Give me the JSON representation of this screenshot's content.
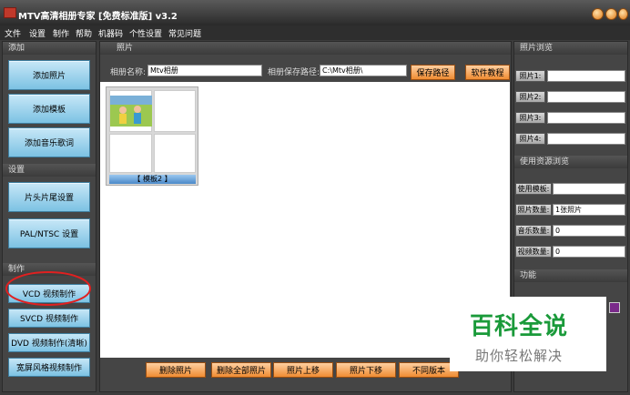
{
  "window": {
    "title": "MTV高清相册专家 [免费标准版] v3.2"
  },
  "menu": [
    "文件",
    "设置",
    "制作",
    "帮助",
    "机器码",
    "个性设置",
    "常见问题"
  ],
  "left": {
    "add_header": "添加",
    "add_photo": "添加照片",
    "add_template": "添加模板",
    "add_music": "添加音乐歌词",
    "settings_header": "设置",
    "head_tail": "片头片尾设置",
    "pal_ntsc": "PAL/NTSC 设置",
    "make_header": "制作",
    "vcd": "VCD 视频制作",
    "svcd": "SVCD 视频制作",
    "dvd": "DVD 视频制作(清晰)",
    "widescreen": "宽屏风格视频制作"
  },
  "center": {
    "header": "照片",
    "album_name_label": "相册名称:",
    "album_name_value": "Mtv相册",
    "save_path_label": "相册保存路径:",
    "save_path_value": "C:\\Mtv相册\\",
    "save_path_btn": "保存路径",
    "tutorial_btn": "软件教程",
    "template_caption": "【 模板2 】",
    "bottom_buttons": [
      "删除照片",
      "删除全部照片",
      "照片上移",
      "照片下移",
      "不同版本"
    ]
  },
  "right": {
    "preview_header": "照片浏览",
    "photo_labels": [
      "照片1:",
      "照片2:",
      "照片3:",
      "照片4:"
    ],
    "resource_header": "使用资源浏览",
    "template_label": "使用模板:",
    "template_value": "",
    "photo_count_label": "照片数量:",
    "photo_count_value": "1张照片",
    "music_count_label": "音乐数量:",
    "music_count_value": "0",
    "video_count_label": "视频数量:",
    "video_count_value": "0",
    "function_header": "功能"
  },
  "watermark": {
    "title": "百科全说",
    "subtitle": "助你轻松解决"
  },
  "colors": {
    "accent_blue": "#7cc2e3",
    "accent_orange": "#f08c32",
    "highlight_ellipse": "#e02020",
    "watermark_green": "#1a9a3a"
  }
}
